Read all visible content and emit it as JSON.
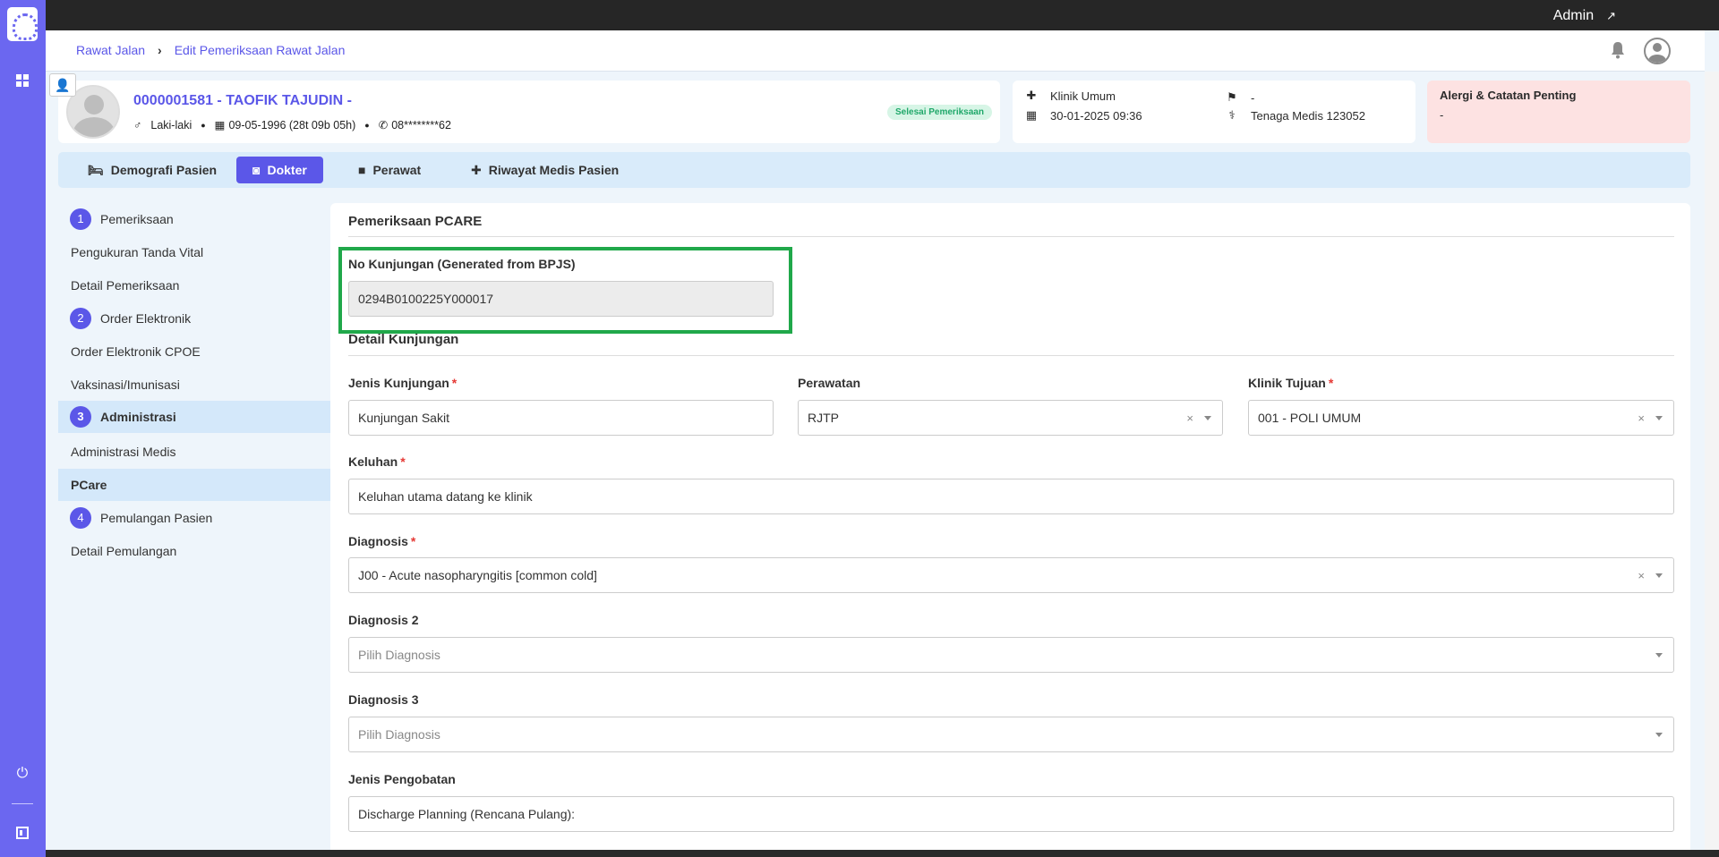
{
  "topbar": {
    "user_label": "Admin",
    "external_icon": "arrow-up-right-icon"
  },
  "sidebar": {
    "icons": [
      "app-logo",
      "grid-icon",
      "power-icon",
      "panel-icon"
    ]
  },
  "breadcrumb": {
    "items": [
      "Rawat Jalan",
      "Edit Pemeriksaan Rawat Jalan"
    ]
  },
  "patient": {
    "name": "0000001581 - TAOFIK TAJUDIN -",
    "gender": "Laki-laki",
    "dob": "09-05-1996 (28t 09b 05h)",
    "phone": "08********62",
    "status": "Selesai Pemeriksaan"
  },
  "visit": {
    "clinic": "Klinik Umum",
    "datetime": "30-01-2025 09:36",
    "flag": "-",
    "medic": "Tenaga Medis 123052"
  },
  "allergy": {
    "title": "Alergi & Catatan Penting",
    "value": "-"
  },
  "tabs": [
    {
      "label": "Demografi Pasien",
      "icon": "person-bed-icon"
    },
    {
      "label": "Dokter",
      "icon": "doctor-icon"
    },
    {
      "label": "Perawat",
      "icon": "nurse-icon"
    },
    {
      "label": "Riwayat Medis Pasien",
      "icon": "medical-cross-icon"
    }
  ],
  "steps": {
    "s1": {
      "num": "1",
      "label": "Pemeriksaan",
      "items": [
        "Pengukuran Tanda Vital",
        "Detail Pemeriksaan"
      ]
    },
    "s2": {
      "num": "2",
      "label": "Order Elektronik",
      "items": [
        "Order Elektronik CPOE",
        "Vaksinasi/Imunisasi"
      ]
    },
    "s3": {
      "num": "3",
      "label": "Administrasi",
      "items": [
        "Administrasi Medis",
        "PCare"
      ]
    },
    "s4": {
      "num": "4",
      "label": "Pemulangan Pasien",
      "items": [
        "Detail Pemulangan"
      ]
    }
  },
  "form": {
    "section1_title": "Pemeriksaan PCARE",
    "no_kunjungan_label": "No Kunjungan (Generated from BPJS)",
    "no_kunjungan_value": "0294B0100225Y000017",
    "section2_title": "Detail Kunjungan",
    "jenis_kunjungan_label": "Jenis Kunjungan",
    "jenis_kunjungan_value": "Kunjungan Sakit",
    "perawatan_label": "Perawatan",
    "perawatan_value": "RJTP",
    "klinik_tujuan_label": "Klinik Tujuan",
    "klinik_tujuan_value": "001 - POLI UMUM",
    "keluhan_label": "Keluhan",
    "keluhan_value": "Keluhan utama datang ke klinik",
    "diagnosis_label": "Diagnosis",
    "diagnosis_value": "J00 - Acute nasopharyngitis [common cold]",
    "diagnosis2_label": "Diagnosis 2",
    "diagnosis2_placeholder": "Pilih Diagnosis",
    "diagnosis3_label": "Diagnosis 3",
    "diagnosis3_placeholder": "Pilih Diagnosis",
    "jenis_pengobatan_label": "Jenis Pengobatan",
    "jenis_pengobatan_value": "Discharge Planning (Rencana Pulang):",
    "required_mark": "*",
    "clear_mark": "×"
  },
  "colors": {
    "accent": "#5b57e8",
    "sidebar": "#6b67f0",
    "highlight": "#20a84a",
    "allergy_bg": "#fde2e2",
    "status_green": "#20a86a"
  }
}
